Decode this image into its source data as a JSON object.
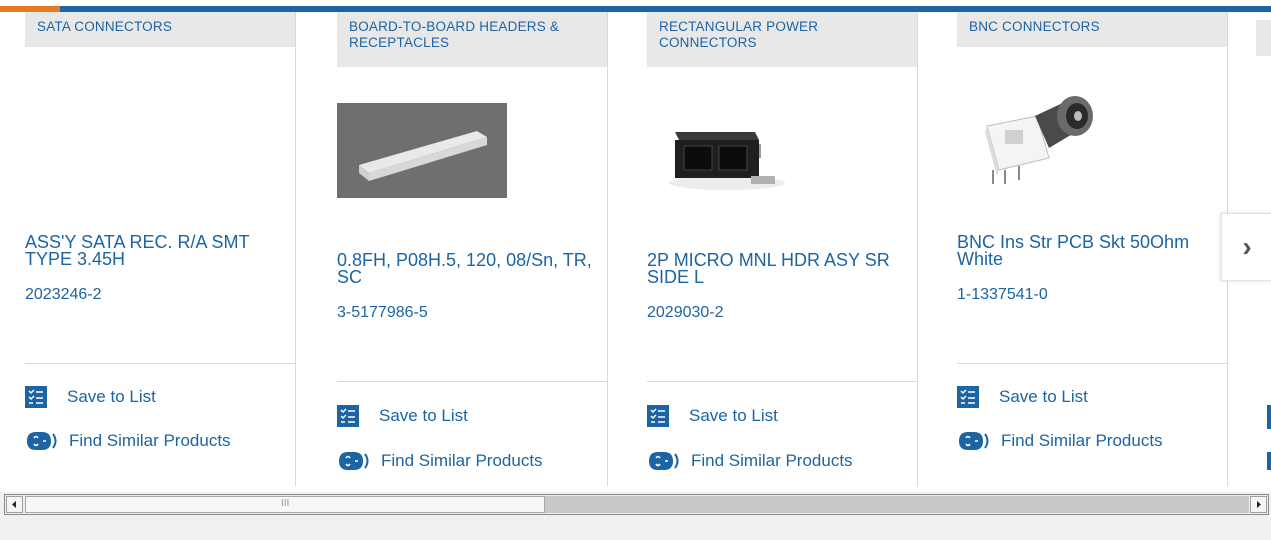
{
  "carousel": {
    "cards": [
      {
        "category": "SATA CONNECTORS",
        "title": "ASS'Y SATA REC. R/A SMT TYPE 3.45H",
        "part_number": "2023246-2",
        "save_label": "Save to List",
        "similar_label": "Find Similar Products"
      },
      {
        "category": "BOARD-TO-BOARD HEADERS & RECEPTACLES",
        "title": "0.8FH, P08H.5, 120, 08/Sn, TR, SC",
        "part_number": "3-5177986-5",
        "save_label": "Save to List",
        "similar_label": "Find Similar Products"
      },
      {
        "category": "RECTANGULAR POWER CONNECTORS",
        "title": "2P MICRO MNL HDR ASY SR SIDE L",
        "part_number": "2029030-2",
        "save_label": "Save to List",
        "similar_label": "Find Similar Products"
      },
      {
        "category": "BNC CONNECTORS",
        "title": "BNC Ins Str PCB Skt 50Ohm White",
        "part_number": "1-1337541-0",
        "save_label": "Save to List",
        "similar_label": "Find Similar Products"
      }
    ],
    "next_icon": "chevron-right-icon",
    "scroll_thumb_grip": "III"
  },
  "colors": {
    "accent": "#1c64a3",
    "top_accent": "#e57b25"
  }
}
